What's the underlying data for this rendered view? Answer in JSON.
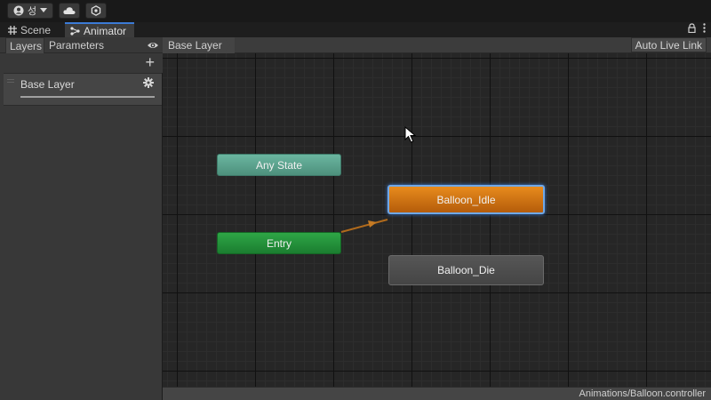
{
  "toolbar": {
    "account_glyph": "성",
    "account_icon": "account-icon",
    "cloud_icon": "cloud-icon",
    "collab_icon": "collab-icon"
  },
  "tabs": [
    {
      "label": "Scene",
      "icon": "grid-icon",
      "active": false
    },
    {
      "label": "Animator",
      "icon": "animator-icon",
      "active": true
    }
  ],
  "left_panel": {
    "tabs": [
      "Layers",
      "Parameters"
    ],
    "layers": [
      {
        "name": "Base Layer"
      }
    ]
  },
  "graph": {
    "breadcrumb": "Base Layer",
    "auto_live_link_label": "Auto Live Link",
    "nodes": {
      "any_state": "Any State",
      "entry": "Entry",
      "balloon_idle": "Balloon_Idle",
      "balloon_die": "Balloon_Die"
    }
  },
  "status": {
    "controller_path": "Animations/Balloon.controller"
  },
  "colors": {
    "accent": "#3b7bd6",
    "default_state": "#e07b12",
    "entry": "#1f8c36",
    "any_state": "#5fa390",
    "transition": "#b06a1c"
  }
}
